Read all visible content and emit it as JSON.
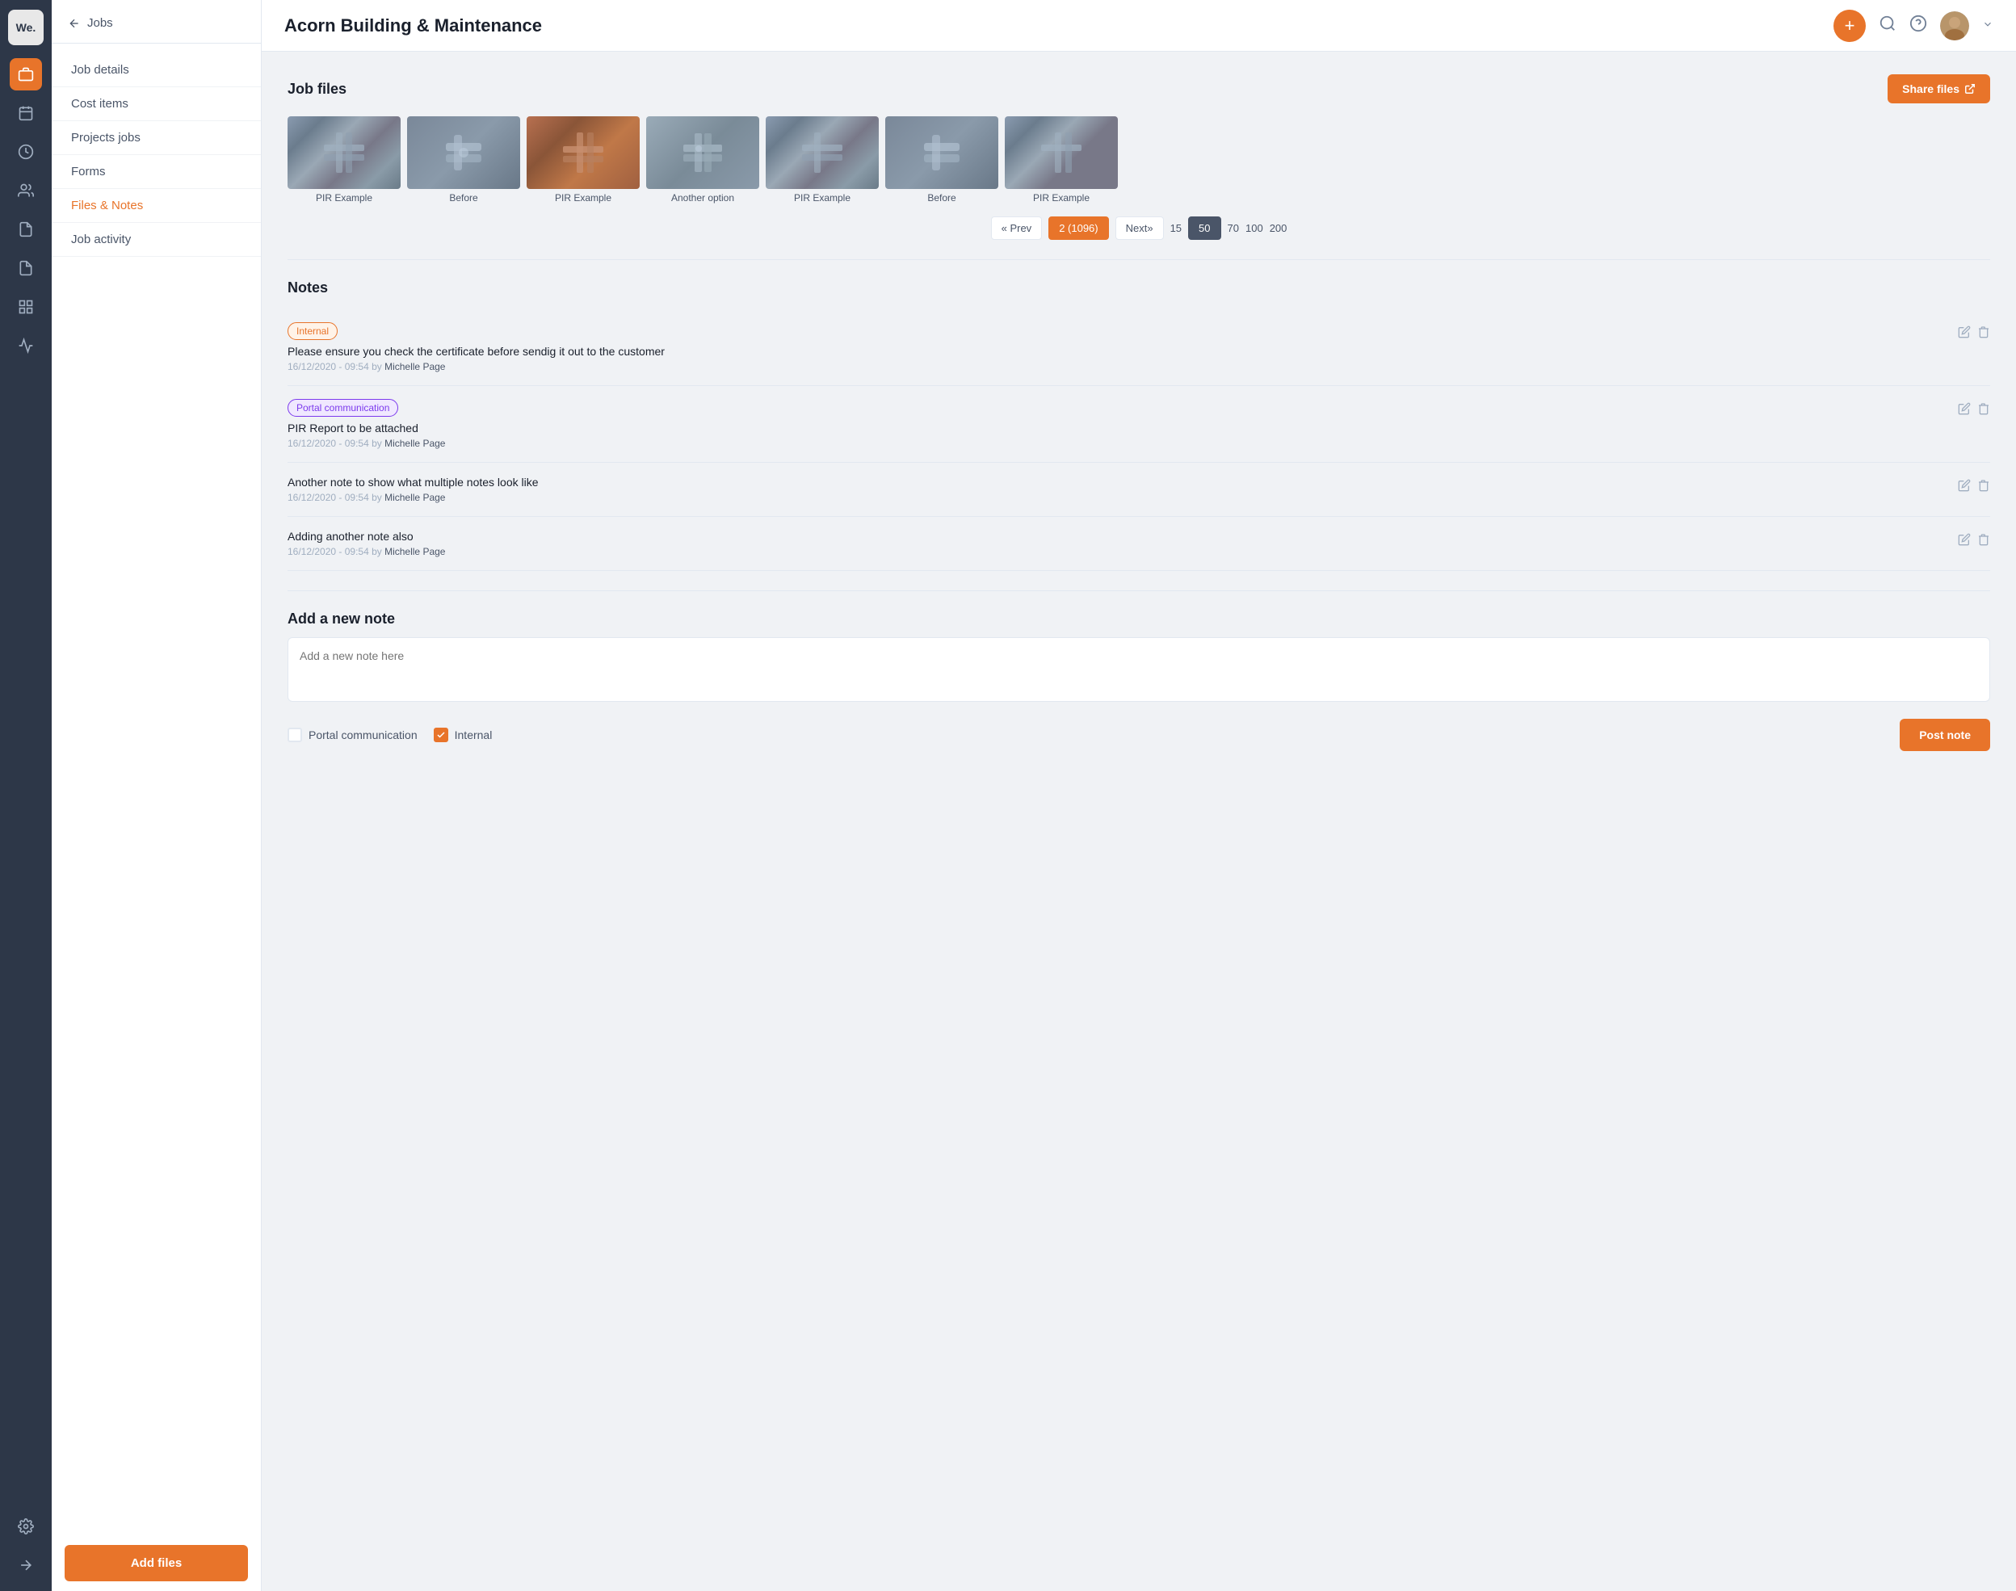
{
  "app": {
    "logo": "We.",
    "title": "Acorn Building & Maintenance"
  },
  "rail": {
    "icons": [
      {
        "name": "briefcase-icon",
        "symbol": "💼",
        "active": true
      },
      {
        "name": "calendar-icon",
        "symbol": "📅",
        "active": false
      },
      {
        "name": "clock-icon",
        "symbol": "⏱",
        "active": false
      },
      {
        "name": "users-icon",
        "symbol": "👥",
        "active": false
      },
      {
        "name": "report-icon",
        "symbol": "📋",
        "active": false
      },
      {
        "name": "document-icon",
        "symbol": "📄",
        "active": false
      },
      {
        "name": "grid-icon",
        "symbol": "⊞",
        "active": false
      },
      {
        "name": "chart-icon",
        "symbol": "📊",
        "active": false
      }
    ],
    "bottom_icons": [
      {
        "name": "settings-icon",
        "symbol": "⚙️"
      },
      {
        "name": "arrow-right-icon",
        "symbol": "→"
      }
    ]
  },
  "sidebar": {
    "back_label": "Jobs",
    "nav_items": [
      {
        "label": "Job details",
        "active": false
      },
      {
        "label": "Cost items",
        "active": false
      },
      {
        "label": "Projects jobs",
        "active": false
      },
      {
        "label": "Forms",
        "active": false
      },
      {
        "label": "Files & Notes",
        "active": true
      },
      {
        "label": "Job activity",
        "active": false
      }
    ],
    "add_button": "Add files"
  },
  "header": {
    "search_title": "search",
    "help_title": "help",
    "plus_title": "add",
    "user_dropdown": "user menu"
  },
  "job_files": {
    "section_title": "Job files",
    "share_button": "Share files",
    "images": [
      {
        "label": "PIR Example",
        "type": "pipe1"
      },
      {
        "label": "Before",
        "type": "pipe2"
      },
      {
        "label": "PIR Example",
        "type": "pipe3"
      },
      {
        "label": "Another option",
        "type": "pipe4"
      },
      {
        "label": "PIR Example",
        "type": "pipe1"
      },
      {
        "label": "Before",
        "type": "pipe2"
      },
      {
        "label": "PIR Example",
        "type": "pipe1"
      }
    ],
    "pagination": {
      "prev": "« Prev",
      "current": "2 (1096)",
      "next": "Next»",
      "sizes": [
        "15",
        "50",
        "70",
        "100",
        "200"
      ],
      "active_size": "50"
    }
  },
  "notes": {
    "section_title": "Notes",
    "items": [
      {
        "tag": "Internal",
        "tag_type": "internal",
        "text": "Please ensure you check the certificate before sendig it out to the customer",
        "timestamp": "16/12/2020 - 09:54",
        "author": "Michelle Page"
      },
      {
        "tag": "Portal communication",
        "tag_type": "portal",
        "text": "PIR Report to be attached",
        "timestamp": "16/12/2020 - 09:54",
        "author": "Michelle Page"
      },
      {
        "tag": null,
        "tag_type": null,
        "text": "Another note to show what multiple notes look like",
        "timestamp": "16/12/2020 - 09:54",
        "author": "Michelle Page"
      },
      {
        "tag": null,
        "tag_type": null,
        "text": "Adding another note also",
        "timestamp": "16/12/2020 - 09:54",
        "author": "Michelle Page"
      }
    ]
  },
  "add_note": {
    "section_title": "Add a new note",
    "placeholder": "Add a new note here",
    "portal_label": "Portal communication",
    "internal_label": "Internal",
    "post_button": "Post note",
    "portal_checked": false,
    "internal_checked": true
  }
}
